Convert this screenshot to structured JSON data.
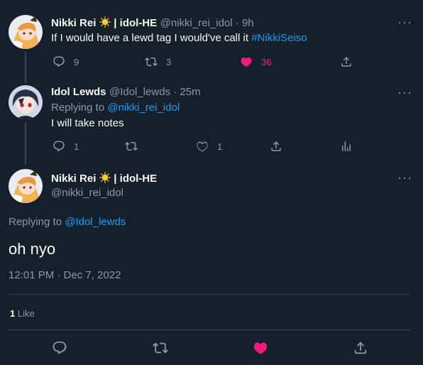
{
  "tweet1": {
    "name": "Nikki Rei",
    "name_suffix": "| idol-HE",
    "handle_time": "@nikki_rei_idol · 9h",
    "text_pre": "If I would have a lewd tag I would've call it ",
    "hashtag": "#NikkiSeiso",
    "replies": "9",
    "retweets": "3",
    "likes": "36"
  },
  "tweet2": {
    "name": "Idol Lewds",
    "handle_time": "@Idol_lewds · 25m",
    "replying_prefix": "Replying to ",
    "replying_to": "@nikki_rei_idol",
    "text": "I will take notes",
    "replies": "1",
    "likes": "1"
  },
  "main": {
    "name": "Nikki Rei",
    "name_suffix": "| idol-HE",
    "handle": "@nikki_rei_idol",
    "replying_prefix": "Replying to ",
    "replying_to": "@Idol_lewds",
    "text": "oh nyo",
    "timestamp": "12:01 PM · Dec 7, 2022",
    "likes_count": "1",
    "likes_label": "Like"
  },
  "colors": {
    "background": "#15202b",
    "link": "#1d9bf0",
    "like_active": "#f91880",
    "muted": "#8b98a5"
  },
  "icons": [
    "reply-icon",
    "retweet-icon",
    "heart-icon",
    "share-icon",
    "analytics-icon",
    "more-icon",
    "sun-emoji-icon"
  ]
}
